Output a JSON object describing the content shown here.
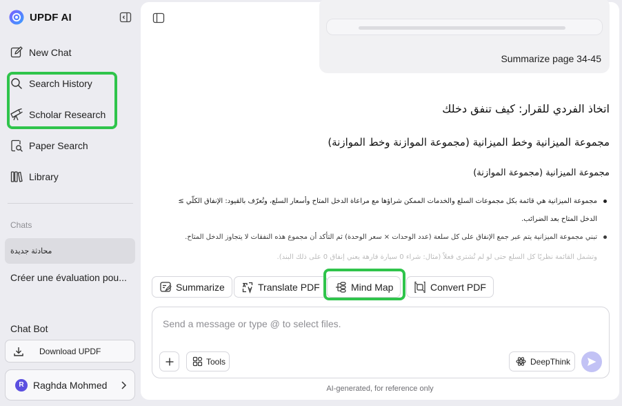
{
  "app": {
    "name": "UPDF AI"
  },
  "sidebar": {
    "new_chat": "New Chat",
    "search_history": "Search History",
    "scholar_research": "Scholar Research",
    "paper_search": "Paper Search",
    "library": "Library",
    "chats_label": "Chats",
    "chats": [
      {
        "title": "محادثة جديدة",
        "active": true
      },
      {
        "title": "Créer une évaluation pou...",
        "active": false
      }
    ],
    "chatbot_label": "Chat Bot",
    "download_label": "Download UPDF",
    "user": {
      "name": "Raghda Mohmed",
      "initial": "R"
    }
  },
  "conversation": {
    "user_message": "Summarize page 34-45",
    "heading1": "اتخاذ الفردي للقرار: كيف تنفق دخلك",
    "heading2": "مجموعة الميزانية وخط الميزانية (مجموعة الموازنة وخط الموازنة)",
    "heading3": "مجموعة الميزانية (مجموعة الموازنة)",
    "bullets": [
      "مجموعة الميزانية هي قائمة بكل مجموعات السلع والخدمات الممكن شراؤها مع مراعاة الدخل المتاح وأسعار السلع، وتُعرّف بالقيود: الإنفاق الكلّي ≥ الدخل المتاح بعد الضرائب.",
      "تبني مجموعة الميزانية يتم عبر جمع الإنفاق على كل سلعة (عدد الوحدات × سعر الوحدة) ثم التأكد أن مجموع هذه النفقات لا يتجاوز الدخل المتاح."
    ],
    "faded_line": "وتشمل القائمة نظريًا كل السلع حتى لو لم تُشترى فعلاً (مثال: شراء 0 سيارة فارهة يعني إنفاق 0 على ذلك البند)."
  },
  "actions": {
    "summarize": "Summarize",
    "translate": "Translate PDF",
    "mindmap": "Mind Map",
    "convert": "Convert PDF"
  },
  "composer": {
    "placeholder": "Send a message or type @ to select files.",
    "tools_label": "Tools",
    "deepthink_label": "DeepThink"
  },
  "footer_note": "AI-generated, for reference only",
  "colors": {
    "highlight": "#2fc44b",
    "accent": "#5b4fe0",
    "send_button": "#c2c2f5",
    "sidebar_bg": "#ececf1",
    "panel_bg": "#ffffff"
  },
  "icons": [
    "updf-logo-icon",
    "sidebar-collapse-icon",
    "new-chat-icon",
    "search-icon",
    "telescope-icon",
    "paper-search-icon",
    "library-icon",
    "download-icon",
    "chevron-right-icon",
    "panel-icon",
    "close-icon",
    "summarize-icon",
    "translate-icon",
    "mindmap-icon",
    "convert-icon",
    "plus-icon",
    "tools-icon",
    "deepthink-icon",
    "send-icon"
  ]
}
